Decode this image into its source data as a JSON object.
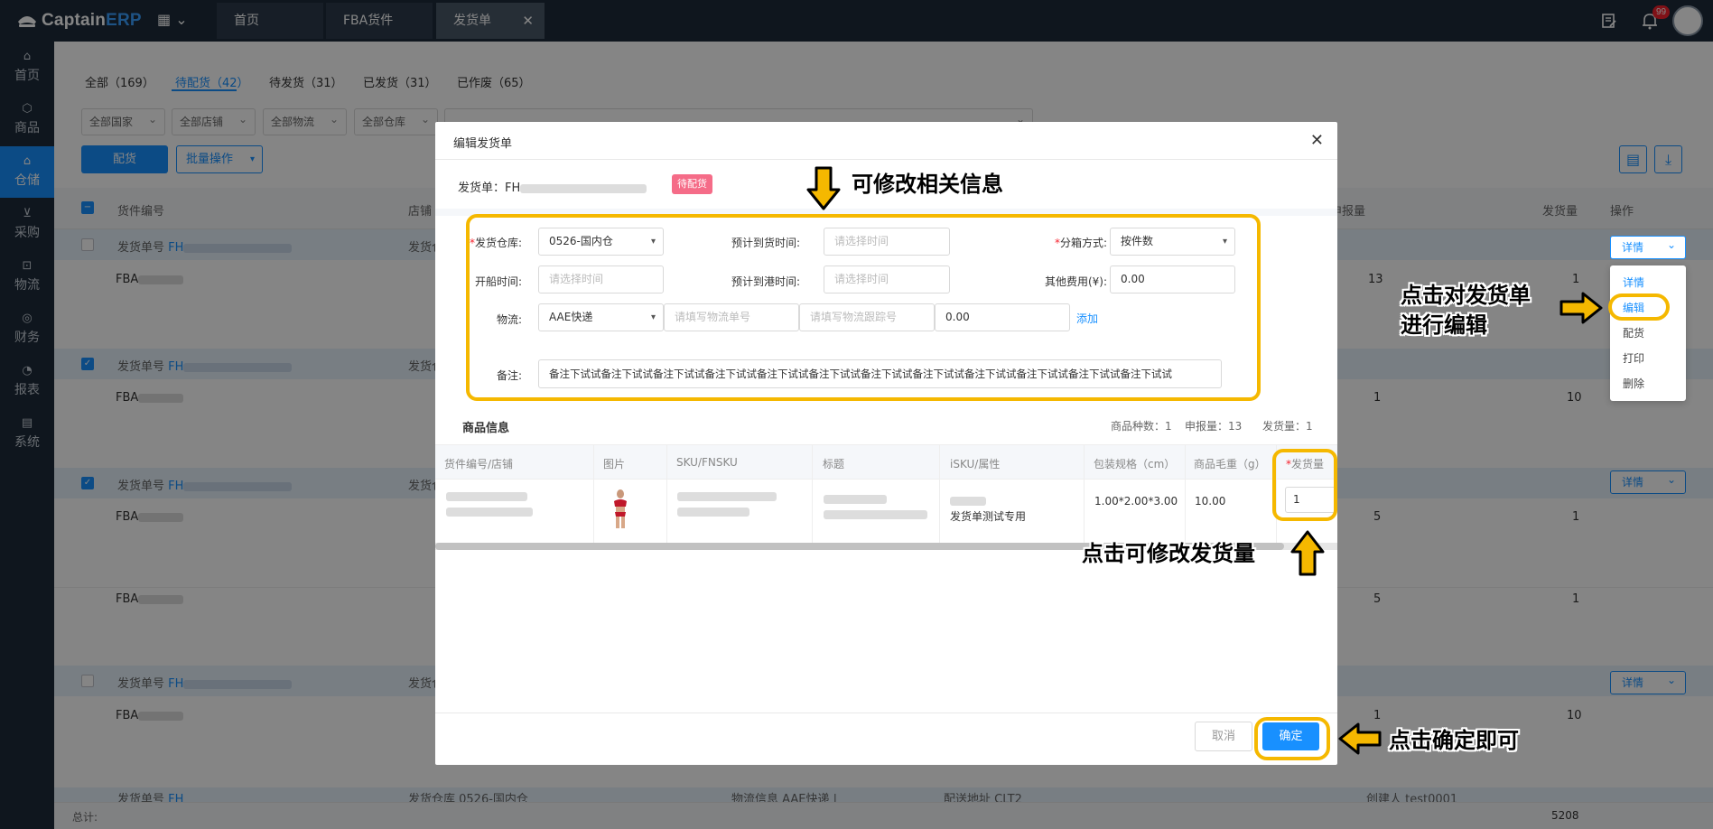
{
  "app": {
    "logo_prefix": "Captain",
    "logo_suffix": "ERP"
  },
  "tabs": [
    {
      "label": "首页"
    },
    {
      "label": "FBA货件"
    },
    {
      "label": "发货单"
    }
  ],
  "notifications": {
    "count": "99"
  },
  "sidebar": {
    "items": [
      {
        "label": "首页"
      },
      {
        "label": "商品"
      },
      {
        "label": "仓储"
      },
      {
        "label": "采购"
      },
      {
        "label": "物流"
      },
      {
        "label": "财务"
      },
      {
        "label": "报表"
      },
      {
        "label": "系统"
      }
    ]
  },
  "filter_tabs": [
    {
      "label": "全部（169）"
    },
    {
      "label": "待配货（42）"
    },
    {
      "label": "待发货（31）"
    },
    {
      "label": "已发货（31）"
    },
    {
      "label": "已作废（65）"
    }
  ],
  "filters": {
    "country": "全部国家",
    "shop": "全部店铺",
    "logistics": "全部物流",
    "warehouse": "全部仓库"
  },
  "toolbar": {
    "allocate": "配货",
    "batch": "批量操作"
  },
  "table": {
    "headers": {
      "shipment_no": "货件编号",
      "shop": "店铺",
      "declared": "申报量",
      "shipped": "发货量",
      "action": "操作"
    },
    "group_label": "发货单号",
    "group_prefix": "FH",
    "shop_label": "发货仓",
    "row_prefix": "FBA",
    "values": {
      "r1_declared": "13",
      "r1_shipped": "1",
      "r2_declared": "1",
      "r2_shipped": "10",
      "r3_declared": "5",
      "r3_shipped": "1",
      "r4_declared": "5",
      "r4_shipped": "1",
      "r5_declared": "1",
      "r5_shipped": "10"
    },
    "partial_row": {
      "warehouse": "发货仓库 0526-国内仓",
      "logistics": "物流信息 AAE快递 |",
      "address": "配送地址 CLT2",
      "creator": "创建人 test0001"
    },
    "detail_btn": "详情",
    "footer_label": "总计:",
    "footer_total": "5208"
  },
  "dropdown": {
    "items": [
      {
        "label": "详情"
      },
      {
        "label": "编辑"
      },
      {
        "label": "配货"
      },
      {
        "label": "打印"
      },
      {
        "label": "删除"
      }
    ]
  },
  "modal": {
    "title": "编辑发货单",
    "shipment_label": "发货单：FH",
    "status": "待配货",
    "form": {
      "warehouse_label": "发货仓库:",
      "warehouse_value": "0526-国内仓",
      "eta_label": "预计到货时间:",
      "time_placeholder": "请选择时间",
      "box_label": "分箱方式:",
      "box_value": "按件数",
      "sail_label": "开船时间:",
      "port_label": "预计到港时间:",
      "fee_label": "其他费用(¥):",
      "fee_value": "0.00",
      "logistics_label": "物流:",
      "logistics_value": "AAE快递",
      "tracking_placeholder": "请填写物流单号",
      "trace_placeholder": "请填写物流跟踪号",
      "cost_value": "0.00",
      "add_link": "添加",
      "remark_label": "备注:",
      "remark_value": "备注下试试备注下试试备注下试试备注下试试备注下试试备注下试试备注下试试备注下试试备注下试试备注下试试备注下试试备注下试试"
    },
    "items_section": {
      "title": "商品信息",
      "kinds_label": "商品种数：1",
      "declared_label": "申报量：13",
      "shipped_label": "发货量：1"
    },
    "items_table": {
      "headers": [
        "货件编号/店铺",
        "图片",
        "SKU/FNSKU",
        "标题",
        "iSKU/属性",
        "包装规格（cm）",
        "商品毛重（g）",
        "发货量"
      ],
      "row": {
        "attr": "发货单测试专用",
        "pack": "1.00*2.00*3.00",
        "weight": "10.00",
        "qty": "1"
      }
    },
    "buttons": {
      "cancel": "取消",
      "ok": "确定"
    }
  },
  "annotations": {
    "edit_info": "可修改相关信息",
    "click_edit_1": "点击对发货单",
    "click_edit_2": "进行编辑",
    "edit_qty": "点击可修改发货量",
    "confirm": "点击确定即可"
  },
  "colors": {
    "accent": "#1890ff",
    "highlight": "#f5b800",
    "sidebar": "#1d2b3a",
    "danger_tag": "#f56c88"
  }
}
